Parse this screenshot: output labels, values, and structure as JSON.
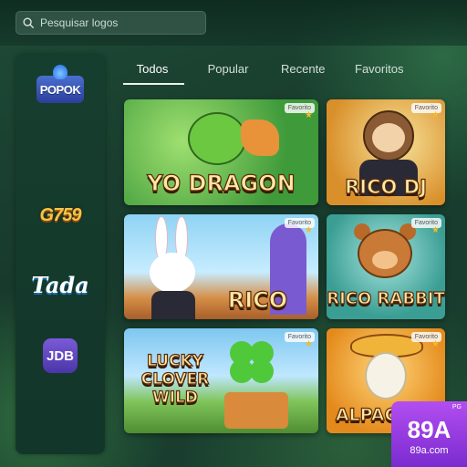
{
  "search": {
    "placeholder": "Pesquisar logos"
  },
  "providers": [
    {
      "name": "POPOK"
    },
    {
      "name": "G759"
    },
    {
      "name": "Tada"
    },
    {
      "name": "JDB"
    }
  ],
  "tabs": [
    {
      "label": "Todos",
      "active": true
    },
    {
      "label": "Popular",
      "active": false
    },
    {
      "label": "Recente",
      "active": false
    },
    {
      "label": "Favoritos",
      "active": false
    }
  ],
  "games": [
    {
      "title": "YO DRAGON",
      "badge": "Favorito"
    },
    {
      "title": "RICO DJ",
      "badge": "Favorito"
    },
    {
      "title": "RICO",
      "badge": "Favorito"
    },
    {
      "title": "RICO RABBIT",
      "badge": "Favorito"
    },
    {
      "title": "LUCKY CLOVER WILD",
      "badge": "Favorito"
    },
    {
      "title": "ALPACA",
      "badge": "Favorito"
    }
  ],
  "watermark": {
    "brand": "89A",
    "domain": "89a.com",
    "tag": "PG"
  },
  "colors": {
    "accent": "#e9f2ec",
    "title_fill": "#ffe9a6",
    "watermark": "#9b3fe6"
  }
}
